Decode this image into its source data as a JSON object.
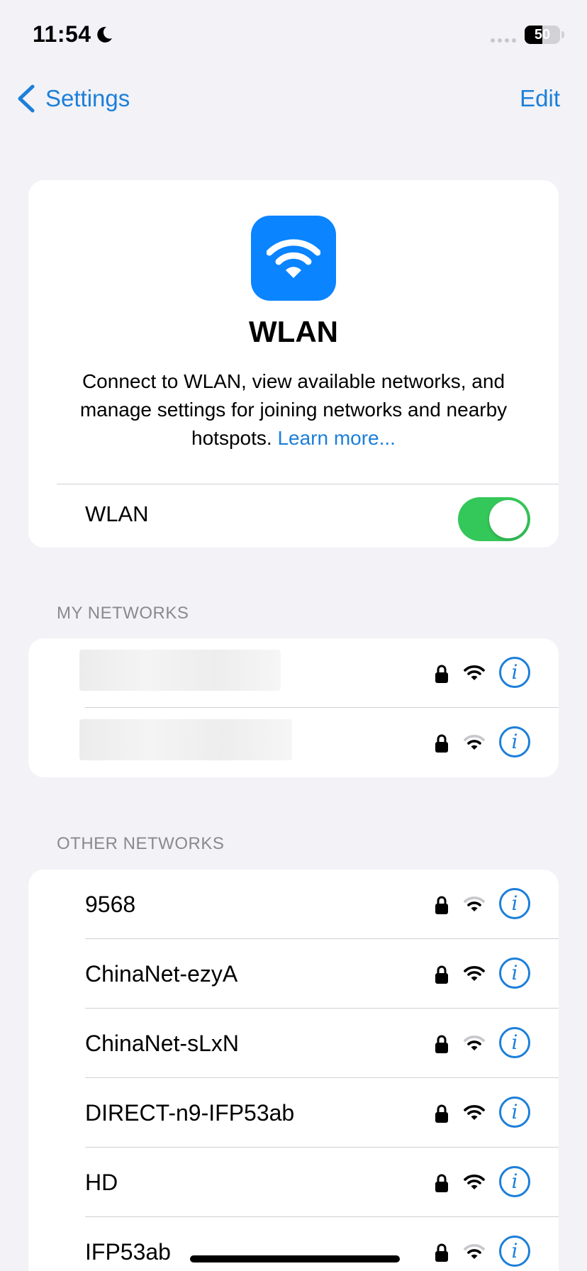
{
  "status_bar": {
    "time": "11:54",
    "battery_percent": "50",
    "battery_level": 0.5
  },
  "nav": {
    "back_label": "Settings",
    "edit_label": "Edit"
  },
  "hero": {
    "title": "WLAN",
    "description": "Connect to WLAN, view available networks, and manage settings for joining networks and nearby hotspots.",
    "learn_more": "Learn more..."
  },
  "wlan_toggle": {
    "label": "WLAN",
    "on": true
  },
  "my_networks": {
    "header": "MY NETWORKS",
    "items": [
      {
        "name": "",
        "redacted": true,
        "secured": true,
        "signal": "strong"
      },
      {
        "name": "",
        "redacted": true,
        "secured": true,
        "signal": "weak"
      }
    ]
  },
  "other_networks": {
    "header": "OTHER NETWORKS",
    "items": [
      {
        "name": "9568",
        "secured": true,
        "signal": "weak"
      },
      {
        "name": "ChinaNet-ezyA",
        "secured": true,
        "signal": "strong"
      },
      {
        "name": "ChinaNet-sLxN",
        "secured": true,
        "signal": "weak"
      },
      {
        "name": "DIRECT-n9-IFP53ab",
        "secured": true,
        "signal": "strong"
      },
      {
        "name": "HD",
        "secured": true,
        "signal": "strong"
      },
      {
        "name": "IFP53ab",
        "secured": true,
        "signal": "weak"
      }
    ]
  },
  "icons": {
    "back": "chevron-left-icon",
    "moon": "moon-icon",
    "wifi": "wifi-icon",
    "lock": "lock-icon",
    "info": "info-icon"
  },
  "colors": {
    "accent": "#1c7fd9",
    "toggle_on": "#34c759",
    "wlan_icon_bg": "#0a84ff",
    "background": "#f2f2f7"
  }
}
